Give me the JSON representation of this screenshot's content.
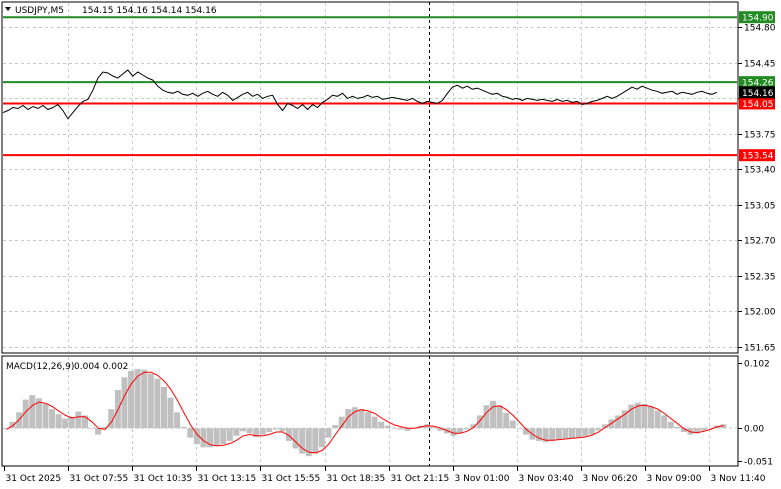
{
  "header": {
    "symbol_timeframe": "USDJPY,M5",
    "ohlc": "154.15 154.16 154.14 154.16"
  },
  "macd_header": {
    "label": "MACD(12,26,9)",
    "values": "0.004 0.002"
  },
  "colors": {
    "price_line": "#000000",
    "resistance_line": "#228b22",
    "support_line": "#ff0000",
    "current_price_badge": "#000000",
    "macd_histogram": "#c0c0c0",
    "macd_signal": "#ff0000",
    "grid": "#c8c8c8",
    "border": "#000000"
  },
  "chart_data": [
    {
      "type": "line",
      "name": "price",
      "ylim": [
        151.6,
        155.04
      ],
      "y_ticks": [
        "154.80",
        "154.45",
        "154.10",
        "153.75",
        "153.40",
        "153.05",
        "152.70",
        "152.35",
        "152.00",
        "151.65"
      ],
      "x_ticks": [
        "31 Oct 2025",
        "31 Oct 07:55",
        "31 Oct 10:35",
        "31 Oct 13:15",
        "31 Oct 15:55",
        "31 Oct 18:35",
        "31 Oct 21:15",
        "3 Nov 01:00",
        "3 Nov 03:40",
        "3 Nov 06:20",
        "3 Nov 09:00",
        "3 Nov 11:40"
      ],
      "grid": true,
      "current_price": "154.16",
      "horizontal_levels": [
        {
          "label": "154.90",
          "value": 154.9,
          "color": "#228b22"
        },
        {
          "label": "154.26",
          "value": 154.26,
          "color": "#228b22"
        },
        {
          "label": "154.05",
          "value": 154.05,
          "color": "#ff0000"
        },
        {
          "label": "153.54",
          "value": 153.54,
          "color": "#ff0000"
        }
      ],
      "values": [
        153.96,
        153.98,
        154.01,
        154.0,
        154.03,
        153.99,
        154.02,
        154.0,
        154.03,
        153.99,
        154.01,
        154.04,
        153.98,
        153.9,
        153.96,
        154.02,
        154.07,
        154.09,
        154.18,
        154.3,
        154.36,
        154.35,
        154.32,
        154.3,
        154.34,
        154.38,
        154.32,
        154.36,
        154.33,
        154.3,
        154.28,
        154.22,
        154.18,
        154.16,
        154.15,
        154.17,
        154.14,
        154.13,
        154.15,
        154.12,
        154.15,
        154.17,
        154.14,
        154.12,
        154.16,
        154.13,
        154.08,
        154.11,
        154.14,
        154.16,
        154.12,
        154.14,
        154.1,
        154.12,
        154.13,
        154.04,
        153.98,
        154.05,
        154.03,
        154.0,
        154.04,
        153.99,
        154.04,
        154.01,
        154.06,
        154.09,
        154.13,
        154.12,
        154.15,
        154.1,
        154.12,
        154.1,
        154.11,
        154.13,
        154.11,
        154.12,
        154.09,
        154.1,
        154.11,
        154.1,
        154.09,
        154.08,
        154.1,
        154.07,
        154.05,
        154.07,
        154.06,
        154.05,
        154.08,
        154.15,
        154.21,
        154.23,
        154.2,
        154.22,
        154.19,
        154.2,
        154.18,
        154.16,
        154.14,
        154.15,
        154.12,
        154.11,
        154.09,
        154.1,
        154.08,
        154.1,
        154.09,
        154.08,
        154.09,
        154.08,
        154.07,
        154.09,
        154.07,
        154.08,
        154.06,
        154.07,
        154.04,
        154.05,
        154.07,
        154.08,
        154.1,
        154.12,
        154.1,
        154.12,
        154.15,
        154.18,
        154.21,
        154.19,
        154.22,
        154.2,
        154.18,
        154.17,
        154.15,
        154.16,
        154.17,
        154.14,
        154.16,
        154.15,
        154.14,
        154.16,
        154.17,
        154.15,
        154.14,
        154.16
      ]
    },
    {
      "type": "bar",
      "name": "MACD",
      "ylim": [
        -0.058,
        0.112
      ],
      "y_ticks": [
        "0.102",
        "0.00",
        "-0.051"
      ],
      "histogram": [
        0.0,
        0.01,
        0.025,
        0.045,
        0.052,
        0.047,
        0.038,
        0.03,
        0.022,
        0.015,
        0.018,
        0.026,
        0.02,
        0.0,
        -0.01,
        0.002,
        0.03,
        0.06,
        0.08,
        0.09,
        0.093,
        0.092,
        0.086,
        0.078,
        0.065,
        0.048,
        0.025,
        0.002,
        -0.015,
        -0.025,
        -0.03,
        -0.03,
        -0.028,
        -0.025,
        -0.02,
        -0.012,
        -0.005,
        -0.008,
        -0.014,
        -0.01,
        -0.006,
        -0.002,
        -0.005,
        -0.02,
        -0.032,
        -0.04,
        -0.044,
        -0.04,
        -0.03,
        -0.015,
        0.005,
        0.018,
        0.03,
        0.033,
        0.03,
        0.025,
        0.018,
        0.01,
        0.004,
        0.0,
        -0.002,
        -0.004,
        0.0,
        0.004,
        0.006,
        0.002,
        -0.004,
        -0.008,
        -0.012,
        -0.008,
        -0.002,
        0.006,
        0.02,
        0.036,
        0.043,
        0.036,
        0.024,
        0.012,
        0.0,
        -0.01,
        -0.018,
        -0.02,
        -0.022,
        -0.02,
        -0.018,
        -0.017,
        -0.016,
        -0.015,
        -0.013,
        -0.01,
        -0.004,
        0.006,
        0.014,
        0.02,
        0.028,
        0.037,
        0.04,
        0.038,
        0.034,
        0.028,
        0.02,
        0.01,
        0.002,
        -0.006,
        -0.01,
        -0.008,
        -0.004,
        0.0,
        0.004,
        0.006
      ],
      "signal": [
        -0.002,
        0.004,
        0.014,
        0.026,
        0.036,
        0.041,
        0.039,
        0.034,
        0.027,
        0.02,
        0.016,
        0.018,
        0.018,
        0.01,
        0.0,
        -0.002,
        0.01,
        0.03,
        0.052,
        0.07,
        0.082,
        0.088,
        0.088,
        0.083,
        0.074,
        0.061,
        0.044,
        0.024,
        0.005,
        -0.01,
        -0.02,
        -0.026,
        -0.028,
        -0.027,
        -0.024,
        -0.019,
        -0.012,
        -0.01,
        -0.012,
        -0.012,
        -0.01,
        -0.006,
        -0.006,
        -0.012,
        -0.022,
        -0.032,
        -0.038,
        -0.039,
        -0.035,
        -0.025,
        -0.01,
        0.004,
        0.018,
        0.026,
        0.029,
        0.027,
        0.023,
        0.016,
        0.01,
        0.005,
        0.002,
        0.0,
        0.0,
        0.002,
        0.004,
        0.003,
        0.0,
        -0.004,
        -0.008,
        -0.008,
        -0.005,
        0.001,
        0.012,
        0.025,
        0.034,
        0.035,
        0.029,
        0.02,
        0.009,
        -0.002,
        -0.01,
        -0.016,
        -0.019,
        -0.019,
        -0.018,
        -0.017,
        -0.016,
        -0.015,
        -0.014,
        -0.011,
        -0.006,
        0.001,
        0.008,
        0.015,
        0.022,
        0.03,
        0.035,
        0.036,
        0.034,
        0.03,
        0.023,
        0.015,
        0.007,
        -0.001,
        -0.006,
        -0.007,
        -0.005,
        -0.002,
        0.002,
        0.004
      ]
    }
  ]
}
